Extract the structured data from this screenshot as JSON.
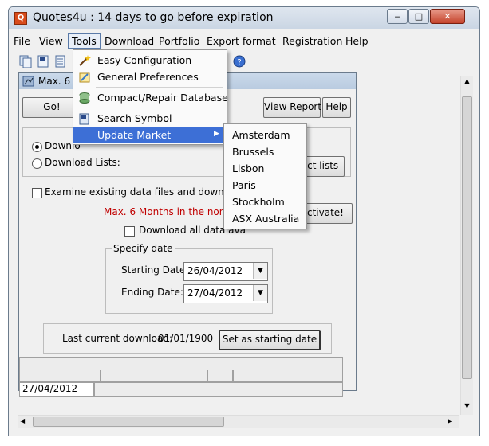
{
  "window": {
    "title": "Quotes4u : 14 days to go before expiration"
  },
  "menubar": [
    "File",
    "View",
    "Tools",
    "Download",
    "Portfolio",
    "Export format",
    "Registration",
    "Help"
  ],
  "child": {
    "title": "Max. 6 M",
    "go_button": "Go!",
    "view_report_button": "View Report",
    "help_button": "Help",
    "radio_download": "Downlo",
    "radio_lists": "Download Lists:",
    "select_lists_button": "ect lists",
    "examine_checkbox": "Examine existing data files and download from l",
    "warning": "Max. 6 Months in the non activ",
    "activate_button": "ctivate!",
    "download_all_checkbox": "Download all data ava",
    "specify_date_legend": "Specify date",
    "starting_label": "Starting Date:",
    "starting_value": "26/04/2012",
    "ending_label": "Ending Date:",
    "ending_value": "27/04/2012",
    "last_download_label": "Last current download:",
    "last_download_value": "01/01/1900",
    "set_start_button": "Set as starting date",
    "status_date": "27/04/2012"
  },
  "tools_menu": {
    "items": [
      {
        "label": "Easy Configuration",
        "icon": "wand-icon"
      },
      {
        "label": "General Preferences",
        "icon": "preferences-icon"
      },
      {
        "label": "Compact/Repair Database",
        "icon": "database-icon"
      },
      {
        "label": "Search Symbol",
        "icon": "search-symbol-icon"
      },
      {
        "label": "Update Market",
        "icon": ""
      }
    ]
  },
  "markets_menu": [
    "Amsterdam",
    "Brussels",
    "Lisbon",
    "Paris",
    "Stockholm",
    "ASX Australia"
  ],
  "colors": {
    "highlight": "#3d6fd6",
    "warning": "#c00000"
  }
}
